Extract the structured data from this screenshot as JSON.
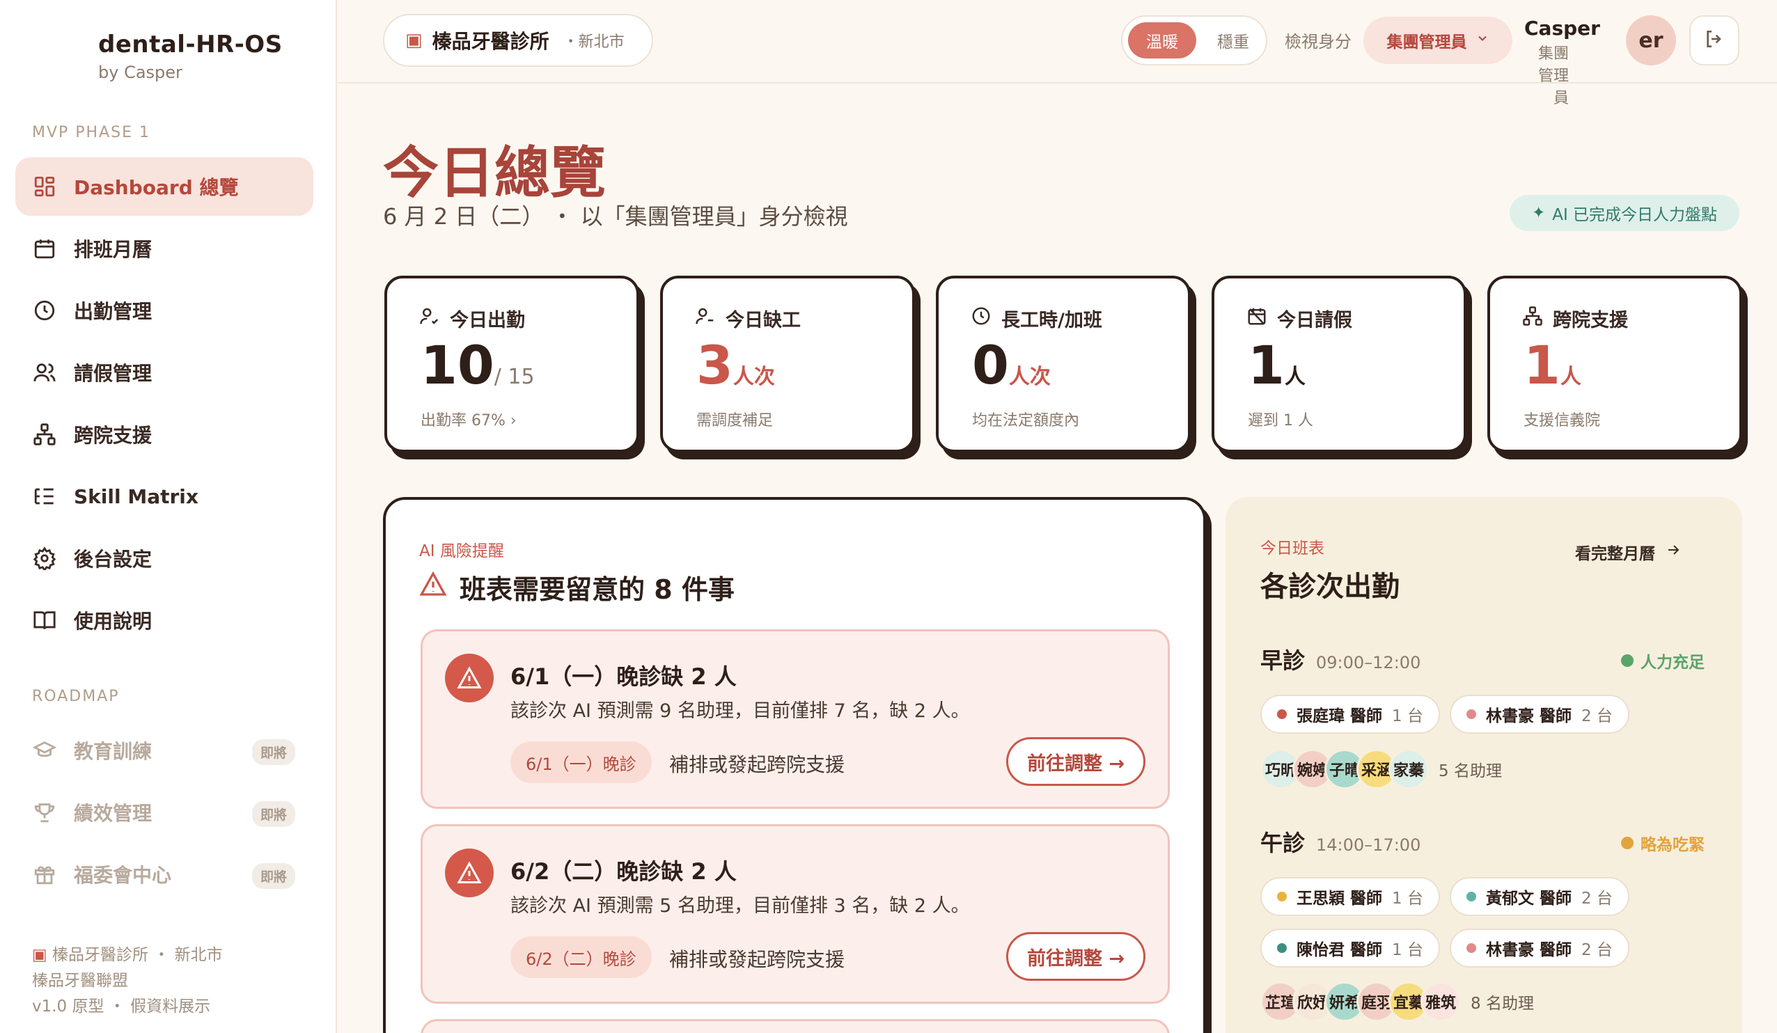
{
  "brand": {
    "title": "dental-HR-OS",
    "subtitle": "by Casper"
  },
  "sidebar": {
    "section1": "MVP PHASE 1",
    "items": [
      {
        "label": "Dashboard 總覽",
        "icon": "dashboard-icon"
      },
      {
        "label": "排班月曆",
        "icon": "calendar-icon"
      },
      {
        "label": "出勤管理",
        "icon": "clock-icon"
      },
      {
        "label": "請假管理",
        "icon": "users-icon"
      },
      {
        "label": "跨院支援",
        "icon": "network-icon"
      },
      {
        "label": "Skill Matrix",
        "icon": "list-icon"
      },
      {
        "label": "後台設定",
        "icon": "gear-icon"
      },
      {
        "label": "使用說明",
        "icon": "book-icon"
      }
    ],
    "section2": "ROADMAP",
    "roadmap": [
      {
        "label": "教育訓練",
        "badge": "即將",
        "icon": "graduation-cap-icon"
      },
      {
        "label": "績效管理",
        "badge": "即將",
        "icon": "trophy-icon"
      },
      {
        "label": "福委會中心",
        "badge": "即將",
        "icon": "gift-icon"
      }
    ],
    "footer": [
      "榛品牙醫診所 ・ 新北市",
      "榛品牙醫聯盟",
      "v1.0 原型 ・ 假資料展示"
    ]
  },
  "topbar": {
    "clinic_name": "榛品牙醫診所",
    "clinic_city": "・新北市",
    "theme_on": "溫暖",
    "theme_off": "穩重",
    "role_label": "檢視身分",
    "role_value": "集團管理員",
    "user_name": "Casper",
    "user_role": "集團管理員",
    "avatar": "er"
  },
  "page": {
    "title": "今日總覽",
    "subtitle": "6 月 2 日（二） ・ 以「集團管理員」身分檢視",
    "ai_badge": "AI 已完成今日人力盤點"
  },
  "stats": [
    {
      "label": "今日出勤",
      "value": "10",
      "unit": "/ 15",
      "note": "出勤率 67% ›",
      "icon": "user-check-icon"
    },
    {
      "label": "今日缺工",
      "value": "3",
      "unit": "人次",
      "note": "需調度補足",
      "icon": "user-minus-icon"
    },
    {
      "label": "長工時/加班",
      "value": "0",
      "unit": "人次",
      "note": "均在法定額度內",
      "icon": "clock-icon"
    },
    {
      "label": "今日請假",
      "value": "1",
      "unit": "人",
      "note": "遲到 1 人",
      "icon": "calendar-off-icon"
    },
    {
      "label": "跨院支援",
      "value": "1",
      "unit": "人",
      "note": "支援信義院",
      "icon": "network-icon"
    }
  ],
  "risk": {
    "tag": "AI 風險提醒",
    "title": "班表需要留意的 8 件事",
    "alerts": [
      {
        "title": "6/1（一）晚診缺 2 人",
        "desc": "該診次 AI 預測需 9 名助理，目前僅排 7 名，缺 2 人。",
        "chip": "6/1（一）晚診",
        "action": "補排或發起跨院支援",
        "button": "前往調整 →"
      },
      {
        "title": "6/2（二）晚診缺 2 人",
        "desc": "該診次 AI 預測需 5 名助理，目前僅排 3 名，缺 2 人。",
        "chip": "6/2（二）晚診",
        "action": "補排或發起跨院支援",
        "button": "前往調整 →"
      }
    ]
  },
  "schedule": {
    "tag": "今日班表",
    "title": "各診次出勤",
    "more": "看完整月曆",
    "slots": [
      {
        "name": "早診",
        "time": "09:00–12:00",
        "status": "人力充足",
        "status_color": "#5aa46a",
        "doctors": [
          {
            "name": "張庭瑋 醫師",
            "count": "1 台",
            "color": "#c9574a"
          },
          {
            "name": "林書豪 醫師",
            "count": "2 台",
            "color": "#e08a8a"
          }
        ],
        "assistants": [
          {
            "n": "巧昕",
            "c": "#dcefe9"
          },
          {
            "n": "婉婷",
            "c": "#f2cfc4"
          },
          {
            "n": "子晴",
            "c": "#a9d9cd"
          },
          {
            "n": "采涵",
            "c": "#f7dc7e"
          },
          {
            "n": "家蓁",
            "c": "#dcefe9"
          }
        ],
        "assist_label": "5 名助理"
      },
      {
        "name": "午診",
        "time": "14:00–17:00",
        "status": "略為吃緊",
        "status_color": "#e3a33e",
        "doctors": [
          {
            "name": "王思穎 醫師",
            "count": "1 台",
            "color": "#e8b33c"
          },
          {
            "name": "黃郁文 醫師",
            "count": "2 台",
            "color": "#5fb3a5"
          },
          {
            "name": "陳怡君 醫師",
            "count": "1 台",
            "color": "#3d8f80"
          },
          {
            "name": "林書豪 醫師",
            "count": "2 台",
            "color": "#e08a8a"
          }
        ],
        "assistants": [
          {
            "n": "芷瑄",
            "c": "#f2cfc4"
          },
          {
            "n": "欣妤",
            "c": "#f6e7da"
          },
          {
            "n": "妍希",
            "c": "#a9d9cd"
          },
          {
            "n": "庭羽",
            "c": "#f2cfc4"
          },
          {
            "n": "宜蓁",
            "c": "#f7dc7e"
          },
          {
            "n": "雅筑",
            "c": "#fbe3e0"
          }
        ],
        "assist_label": "8 名助理"
      }
    ]
  },
  "colors": {
    "accent": "#b4483c",
    "accent_soft": "#f9e3dd",
    "bg": "#fcf8f1",
    "ink": "#2e1f19"
  }
}
